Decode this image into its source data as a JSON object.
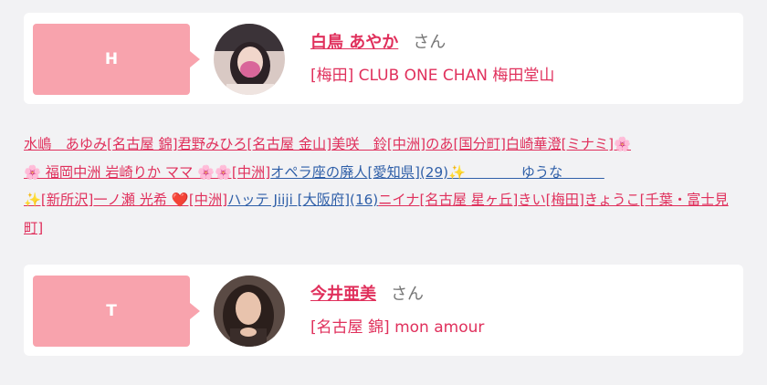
{
  "cards": [
    {
      "tag": "H",
      "name": "白鳥 あやか",
      "suffix": "さん",
      "shop": "[梅田] CLUB ONE CHAN 梅田堂山"
    },
    {
      "tag": "T",
      "name": "今井亜美",
      "suffix": "さん",
      "shop": "[名古屋 錦] mon amour"
    }
  ],
  "links": {
    "l1": "水嶋　あゆみ[名古屋 錦]",
    "l2": "君野みひろ[名古屋 金山]",
    "l3": "美咲　鈴[中洲]",
    "l4": "のあ[国分町]",
    "l5": "白崎華澄[ミナミ]🌸",
    "l6": "🌸 福岡中洲 岩崎りか ママ 🌸🌸[中洲]",
    "l7": "オペラ座の廃人[愛知県](29)✨　　　　ゆうな　　　",
    "l8": "✨[新所沢]",
    "l9": "一ノ瀬 光希 ❤️[中洲]",
    "l10": "ハッテ Jiiji [大阪府](16)",
    "l11": "ニイナ[名古屋 星ヶ丘]",
    "l12": "きい[梅田]",
    "l13": "きょうこ[千葉・富士見町]"
  },
  "colors": {
    "accent": "#e0305c",
    "tag_bg": "#f8a3ad",
    "link_blue": "#2f5fa8",
    "page_bg": "#f2f2f4"
  }
}
